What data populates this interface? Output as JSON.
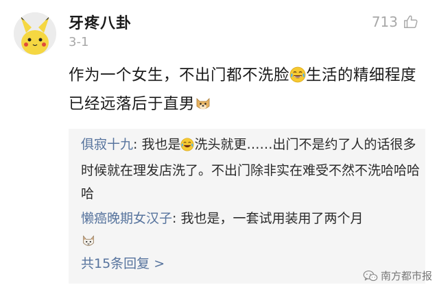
{
  "comment": {
    "username": "牙疼八卦",
    "timestamp": "3-1",
    "like_count": "713",
    "text_part1": "作为一个女生，不出门都不洗脸",
    "text_part2": "生活的精细程度已经远落后于直男"
  },
  "replies": [
    {
      "author": "俱寂十九",
      "separator": ": ",
      "text_part1": "我也是",
      "text_part2": "洗头就更……出门不是约了人的话很多时候就在理发店洗了。不出门除非实在难受不然不洗哈哈哈哈"
    },
    {
      "author": "懒癌晚期女汉子",
      "separator": ": ",
      "text_part1": "我也是，一套试用装用了两个月"
    }
  ],
  "more_replies": "共15条回复 >",
  "watermark": "南方都市报",
  "icons": {
    "avatar": "pikachu-avatar",
    "like": "thumbs-up-icon",
    "emoji_laugh": "tears-of-joy-emoji",
    "emoji_doge": "doge-emoji",
    "emoji_cat": "cat-emoji",
    "watermark_logo": "wechat-logo-icon"
  },
  "colors": {
    "author_link": "#56739d",
    "muted": "#a8a8a8",
    "reply_bg": "#f5f5f5"
  }
}
